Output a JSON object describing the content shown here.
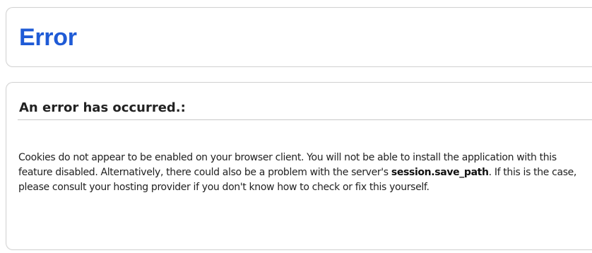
{
  "header": {
    "title": "Error"
  },
  "error": {
    "heading": "An error has occurred.:",
    "message_before": "Cookies do not appear to be enabled on your browser client. You will not be able to install the application with this feature disabled. Alternatively, there could also be a problem with the server's ",
    "message_code": "session.save_path",
    "message_after": ". If this is the case, please consult your hosting provider if you don't know how to check or fix this yourself."
  },
  "colors": {
    "title": "#1f5bd6",
    "text": "#222222",
    "border": "#d2d2d2"
  }
}
